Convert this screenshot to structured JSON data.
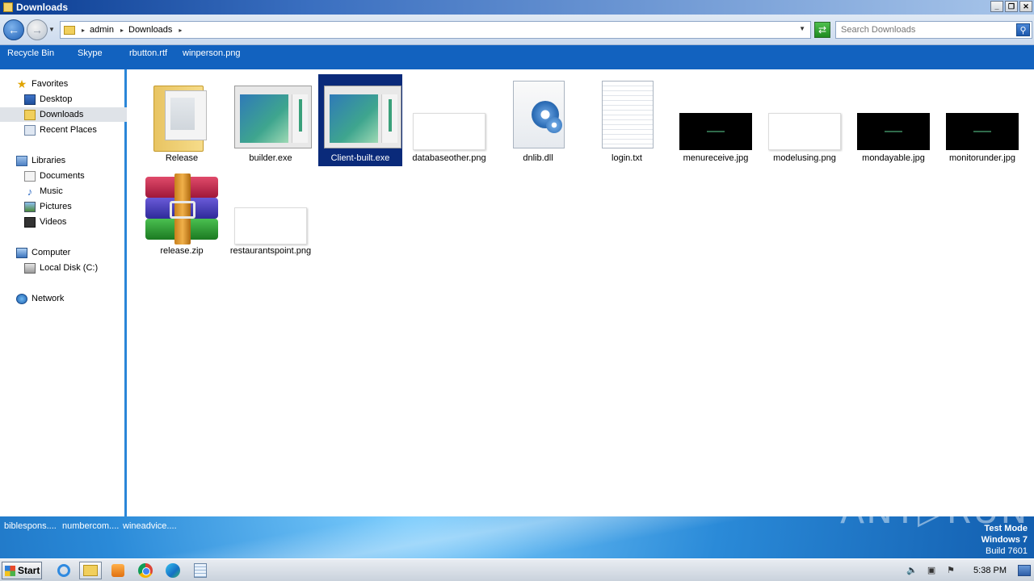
{
  "window": {
    "title": "Downloads",
    "controls": {
      "minimize": "_",
      "restore": "❐",
      "close": "✕"
    }
  },
  "address": {
    "crumbs": [
      "admin",
      "Downloads"
    ],
    "search_placeholder": "Search Downloads"
  },
  "desktop_strip": [
    "Recycle Bin",
    "Skype",
    "rbutton.rtf",
    "winperson.png"
  ],
  "nav": {
    "favorites": "Favorites",
    "desktop": "Desktop",
    "downloads": "Downloads",
    "recent": "Recent Places",
    "libraries": "Libraries",
    "documents": "Documents",
    "music": "Music",
    "pictures": "Pictures",
    "videos": "Videos",
    "computer": "Computer",
    "localdisk": "Local Disk (C:)",
    "network": "Network"
  },
  "files": [
    {
      "name": "Release",
      "type": "folder"
    },
    {
      "name": "builder.exe",
      "type": "exe"
    },
    {
      "name": "Client-built.exe",
      "type": "exe",
      "selected": true
    },
    {
      "name": "databaseother.png",
      "type": "blank"
    },
    {
      "name": "dnlib.dll",
      "type": "dll"
    },
    {
      "name": "login.txt",
      "type": "txt"
    },
    {
      "name": "menureceive.jpg",
      "type": "black"
    },
    {
      "name": "modelusing.png",
      "type": "blank"
    },
    {
      "name": "mondayable.jpg",
      "type": "black"
    },
    {
      "name": "monitorunder.jpg",
      "type": "black"
    },
    {
      "name": "release.zip",
      "type": "zip"
    },
    {
      "name": "restaurantspoint.png",
      "type": "blank"
    }
  ],
  "desktop_bottom": [
    "biblespons....",
    "numbercom....",
    "wineadvice...."
  ],
  "watermark": {
    "line1": "Test Mode",
    "line2": "Windows 7",
    "line3": "Build 7601"
  },
  "anyrun": "ANY▷RUN",
  "taskbar": {
    "start": "Start",
    "clock": "5:38 PM"
  },
  "colors": {
    "selection": "#0a2a7a",
    "titlebar": "#0b3d92",
    "desktop": "#1262bf"
  }
}
